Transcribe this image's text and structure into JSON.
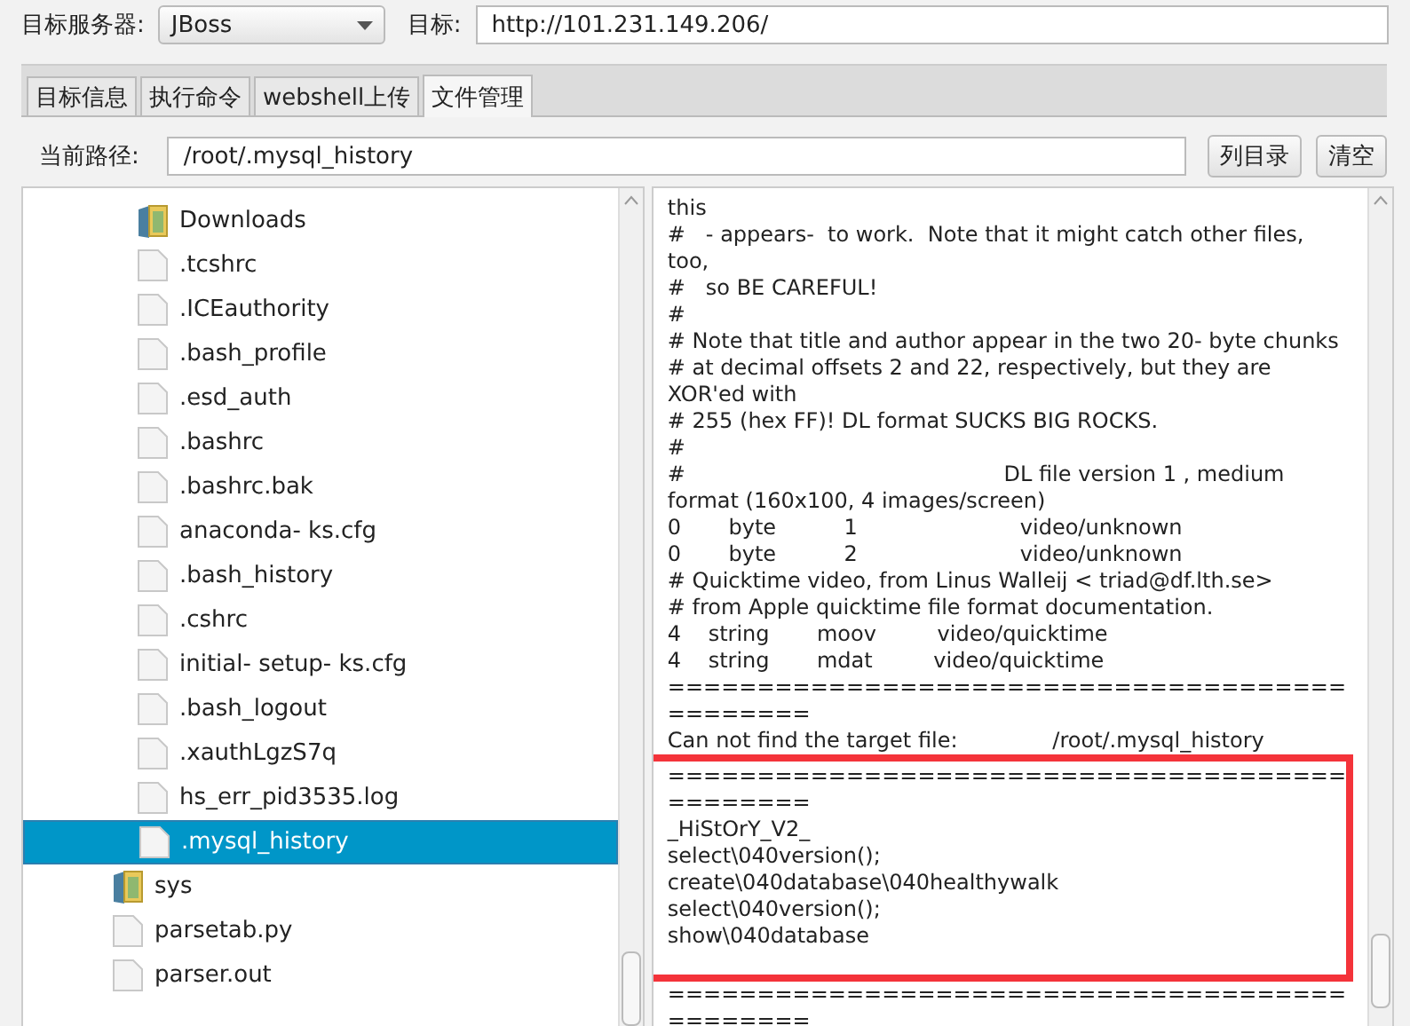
{
  "server_label": "目标服务器:",
  "server_select": {
    "value": "JBoss"
  },
  "target_label": "目标:",
  "target_field": {
    "value": "http://101.231.149.206/"
  },
  "tabs": [
    {
      "label": "目标信息",
      "selected": false
    },
    {
      "label": "执行命令",
      "selected": false
    },
    {
      "label": "webshell上传",
      "selected": false
    },
    {
      "label": "文件管理",
      "selected": true
    }
  ],
  "path_label": "当前路径:",
  "path_field": {
    "value": "/root/.mysql_history"
  },
  "buttons": [
    "列目录",
    "清空"
  ],
  "tree": [
    {
      "children": [
        {
          "label": "Downloads",
          "kind": "folder",
          "selected": false
        },
        {
          "label": ".tcshrc",
          "kind": "file",
          "selected": false
        },
        {
          "label": ".ICEauthority",
          "kind": "file",
          "selected": false
        },
        {
          "label": ".bash_profile",
          "kind": "file",
          "selected": false
        },
        {
          "label": ".esd_auth",
          "kind": "file",
          "selected": false
        },
        {
          "label": ".bashrc",
          "kind": "file",
          "selected": false
        },
        {
          "label": ".bashrc.bak",
          "kind": "file",
          "selected": false
        },
        {
          "label": "anaconda- ks.cfg",
          "kind": "file",
          "selected": false
        },
        {
          "label": ".bash_history",
          "kind": "file",
          "selected": false
        },
        {
          "label": ".cshrc",
          "kind": "file",
          "selected": false
        },
        {
          "label": "initial- setup- ks.cfg",
          "kind": "file",
          "selected": false
        },
        {
          "label": ".bash_logout",
          "kind": "file",
          "selected": false
        },
        {
          "label": ".xauthLgzS7q",
          "kind": "file",
          "selected": false
        },
        {
          "label": "hs_err_pid3535.log",
          "kind": "file",
          "selected": false
        },
        {
          "label": ".mysql_history",
          "kind": "file",
          "selected": true
        }
      ]
    },
    {
      "label": "sys",
      "kind": "folder",
      "selected": false
    },
    {
      "label": "parsetab.py",
      "kind": "file",
      "selected": false
    },
    {
      "label": "parser.out",
      "kind": "file",
      "selected": false
    }
  ],
  "file_lines": [
    "this",
    "#   - appears-  to work.  Note that it might catch other files,",
    "too,",
    "#   so BE CAREFUL!",
    "#",
    "# Note that title and author appear in the two 20- byte chunks",
    "# at decimal offsets 2 and 22, respectively, but they are",
    "XOR'ed with",
    "# 255 (hex FF)! DL format SUCKS BIG ROCKS.",
    "#",
    "#                                               DL file version 1 , medium",
    "format (160x100, 4 images/screen)",
    "0       byte          1                        video/unknown",
    "0       byte          2                        video/unknown",
    "# Quicktime video, from Linus Walleij < triad@df.lth.se>",
    "# from Apple quicktime file format documentation.",
    "4    string       moov         video/quicktime",
    "4    string       mdat         video/quicktime",
    "======================================",
    "========",
    "Can not find the target file:              /root/.mysql_history",
    "======================================",
    "========",
    "_HiStOrY_V2_",
    "select\\040version();",
    "create\\040database\\040healthywalk",
    "select\\040version();",
    "show\\040database",
    "======================================",
    "========"
  ]
}
